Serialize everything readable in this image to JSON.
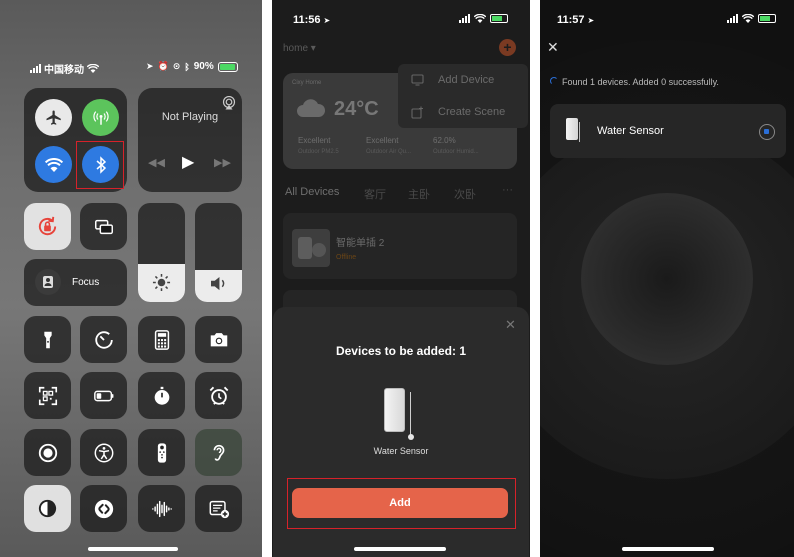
{
  "panel1": {
    "carrier": "中国移动",
    "battery": "90%",
    "now_playing": "Not Playing",
    "focus_label": "Focus",
    "brightness_level": 0.3,
    "volume_level": 0.35
  },
  "panel2": {
    "time": "11:56",
    "home_label": "home",
    "menu": {
      "add_device": "Add Device",
      "create_scene": "Create Scene"
    },
    "weather": {
      "city": "Cixy Home",
      "temperature": "24°C",
      "stats": [
        {
          "value": "Excellent",
          "label": "Outdoor PM2.5"
        },
        {
          "value": "Excellent",
          "label": "Outdoor Air Qu..."
        },
        {
          "value": "62.0%",
          "label": "Outdoor Humid..."
        }
      ]
    },
    "tabs": [
      "All Devices",
      "客厅",
      "主卧",
      "次卧",
      "···"
    ],
    "device": {
      "name": "智能单插 2",
      "status": "Offline"
    },
    "modal": {
      "title": "Devices to be added: 1",
      "device_name": "Water Sensor",
      "add_label": "Add"
    }
  },
  "panel3": {
    "time": "11:57",
    "status_text": "Found 1 devices. Added 0 successfully.",
    "device_name": "Water Sensor"
  }
}
